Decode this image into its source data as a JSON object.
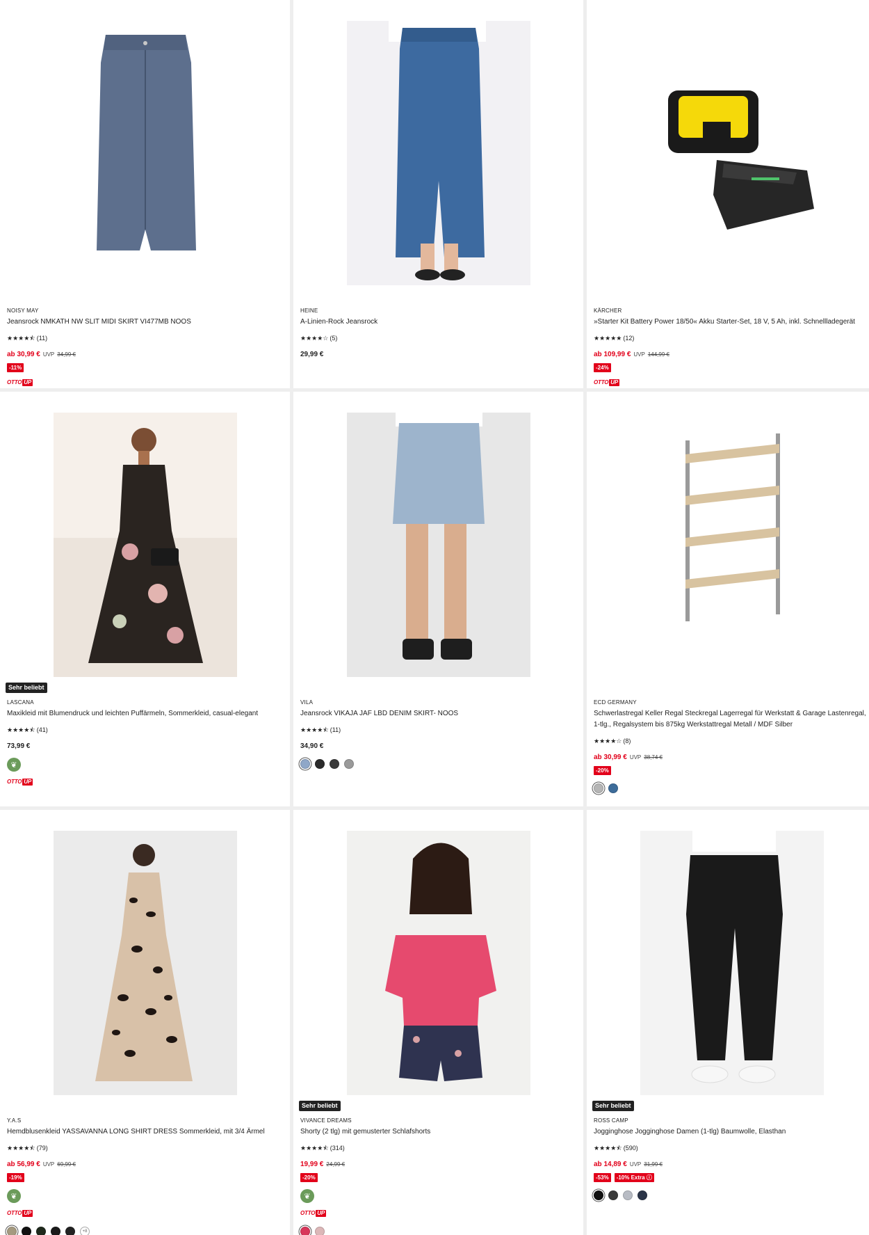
{
  "products": [
    {
      "brand": "NOISY MAY",
      "name": "Jeansrock NMKATH NW SLIT MIDI SKIRT VI477MB NOOS",
      "stars": "★★★★⯪",
      "rating_count": "(11)",
      "price": "ab 30,99 €",
      "uvp_label": "UVP",
      "old_price": "34,99 €",
      "discounts": [
        "-11%"
      ],
      "otto_up": true,
      "image": "denim-midi-skirt-image"
    },
    {
      "brand": "HEINE",
      "name": "A-Linien-Rock Jeansrock",
      "stars": "★★★★☆",
      "rating_count": "(5)",
      "price": "29,99 €",
      "image": "denim-maxi-skirt-image"
    },
    {
      "brand": "KÄRCHER",
      "name": "»Starter Kit Battery Power 18/50« Akku Starter-Set, 18 V, 5 Ah, inkl. Schnellladegerät",
      "stars": "★★★★★",
      "rating_count": "(12)",
      "price": "ab 109,99 €",
      "uvp_label": "UVP",
      "old_price": "144,99 €",
      "discounts": [
        "-24%"
      ],
      "otto_up": true,
      "image": "battery-charger-image"
    },
    {
      "badge": "Sehr beliebt",
      "brand": "LASCANA",
      "name": "Maxikleid mit Blumendruck und leichten Puffärmeln, Sommerkleid, casual-elegant",
      "stars": "★★★★⯪",
      "rating_count": "(41)",
      "price": "73,99 €",
      "eco": true,
      "otto_up": true,
      "image": "floral-maxi-dress-image"
    },
    {
      "brand": "VILA",
      "name": "Jeansrock VIKAJA JAF LBD DENIM SKIRT- NOOS",
      "stars": "★★★★⯪",
      "rating_count": "(11)",
      "price": "34,90 €",
      "swatches": [
        "#8fa7c8",
        "#2b2b2b",
        "#3a3a3a",
        "#9a9a9a"
      ],
      "image": "denim-mini-skirt-image"
    },
    {
      "brand": "ECD GERMANY",
      "name": "Schwerlastregal Keller Regal Steckregal Lagerregal für Werkstatt & Garage Lastenregal, 1-tlg., Regalsystem bis 875kg Werkstattregal Metall / MDF Silber",
      "stars": "★★★★☆",
      "rating_count": "(8)",
      "price": "ab 30,99 €",
      "uvp_label": "UVP",
      "old_price": "38,74 €",
      "discounts": [
        "-20%"
      ],
      "swatches": [
        "#b5b5b5",
        "#3d6c9a"
      ],
      "image": "storage-shelf-image"
    },
    {
      "brand": "Y.A.S",
      "name": "Hemdblusenkleid YASSAVANNA LONG SHIRT DRESS Sommerkleid, mit 3/4 Ärmel",
      "stars": "★★★★⯪",
      "rating_count": "(79)",
      "price": "ab 56,99 €",
      "uvp_label": "UVP",
      "old_price": "69,99 €",
      "discounts": [
        "-19%"
      ],
      "eco": true,
      "otto_up": true,
      "swatches": [
        "#a59a80",
        "#111111",
        "#1f2a1d",
        "#1a1a1a",
        "#222222"
      ],
      "more_swatches": "+8",
      "image": "leopard-shirt-dress-image"
    },
    {
      "badge": "Sehr beliebt",
      "brand": "VIVANCE DREAMS",
      "name": "Shorty (2 tlg) mit gemusterter Schlafshorts",
      "stars": "★★★★⯪",
      "rating_count": "(314)",
      "price": "19,99 €",
      "old_price": "24,99 €",
      "discounts": [
        "-20%"
      ],
      "eco": true,
      "otto_up": true,
      "swatches": [
        "#d8365a",
        "#dcb7b8"
      ],
      "image": "pajama-shorty-image"
    },
    {
      "badge": "Sehr beliebt",
      "brand": "ROSS CAMP",
      "name": "Jogginghose Jogginghose Damen (1-tlg) Baumwolle, Elasthan",
      "stars": "★★★★⯪",
      "rating_count": "(590)",
      "price": "ab 14,89 €",
      "uvp_label": "UVP",
      "old_price": "31,99 €",
      "discounts": [
        "-53%",
        "-10% Extra ⓘ"
      ],
      "swatches": [
        "#111111",
        "#3a3a3a",
        "#b8bcc4",
        "#2b3548"
      ],
      "image": "jogger-pants-image"
    }
  ],
  "otto_up_logo": {
    "otto": "OTTO",
    "up": "UP"
  },
  "eco_icon": "leaf-icon",
  "colors": {
    "sale_red": "#e2001a",
    "eco_green": "#6b9b5a"
  }
}
